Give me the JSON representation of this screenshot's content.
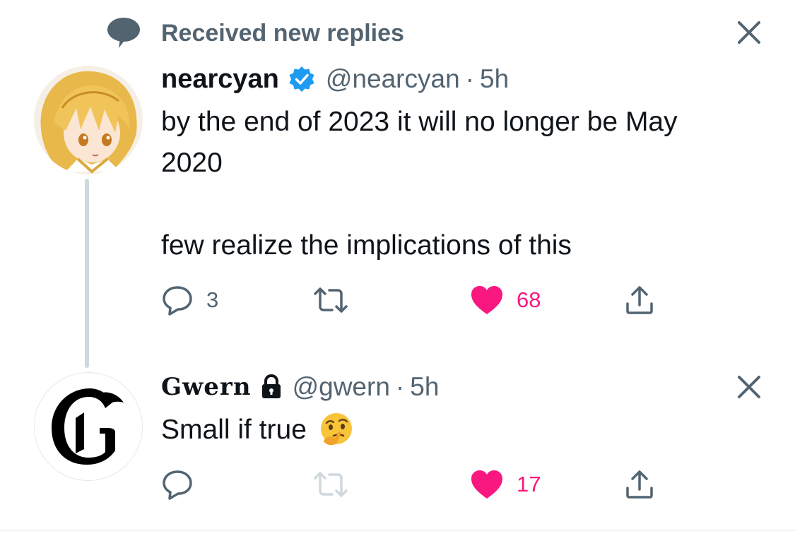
{
  "notification": {
    "title": "Received new replies",
    "icon": "speech-bubble-icon"
  },
  "tweet": {
    "display_name": "nearcyan",
    "verified": true,
    "handle": "@nearcyan",
    "separator": "·",
    "time": "5h",
    "text_line1": "by the end of 2023 it will no longer be May 2020",
    "text_line2": "few realize the implications of this",
    "reply_count": "3",
    "retweet_count": "",
    "like_count": "68",
    "liked": true
  },
  "reply": {
    "display_name": "Gwern",
    "locked": true,
    "handle": "@gwern",
    "separator": "·",
    "time": "5h",
    "text": "Small if true",
    "emoji": "thinking-face",
    "reply_count": "",
    "retweet_count": "",
    "like_count": "17",
    "liked": true
  },
  "colors": {
    "like_pink": "#f91880",
    "muted_grey": "#536471",
    "verified_blue": "#1d9bf0",
    "thread_line": "#cfd9de"
  }
}
